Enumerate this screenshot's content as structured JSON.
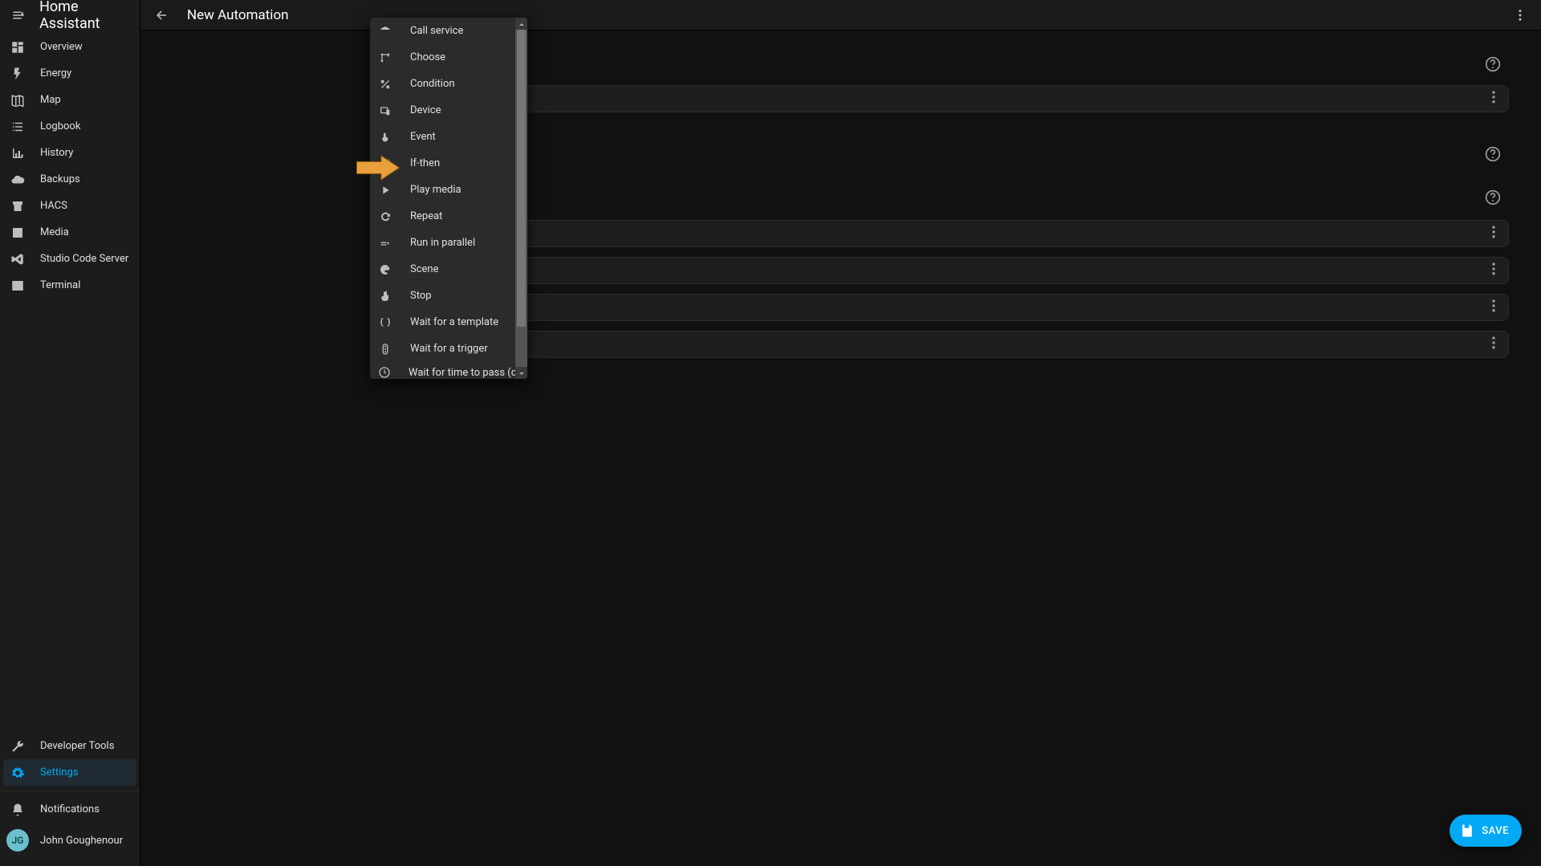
{
  "brand": "Home Assistant",
  "page_title": "New Automation",
  "sidebar": [
    {
      "label": "Overview",
      "icon": "dashboard"
    },
    {
      "label": "Energy",
      "icon": "bolt"
    },
    {
      "label": "Map",
      "icon": "map"
    },
    {
      "label": "Logbook",
      "icon": "list"
    },
    {
      "label": "History",
      "icon": "chart"
    },
    {
      "label": "Backups",
      "icon": "cloud"
    },
    {
      "label": "HACS",
      "icon": "store"
    },
    {
      "label": "Media",
      "icon": "play-box"
    },
    {
      "label": "Studio Code Server",
      "icon": "vscode"
    },
    {
      "label": "Terminal",
      "icon": "terminal"
    }
  ],
  "sidebar_bottom": [
    {
      "label": "Developer Tools",
      "icon": "wrench"
    },
    {
      "label": "Settings",
      "icon": "gear",
      "active": true
    }
  ],
  "notifications_label": "Notifications",
  "user": {
    "initials": "JG",
    "name": "John Goughenour"
  },
  "dropdown_options": [
    {
      "label": "Call service",
      "icon": "bell"
    },
    {
      "label": "Choose",
      "icon": "branch"
    },
    {
      "label": "Condition",
      "icon": "percent"
    },
    {
      "label": "Device",
      "icon": "device"
    },
    {
      "label": "Event",
      "icon": "touch"
    },
    {
      "label": "If-then",
      "icon": "branch",
      "highlighted": true
    },
    {
      "label": "Play media",
      "icon": "play"
    },
    {
      "label": "Repeat",
      "icon": "refresh"
    },
    {
      "label": "Run in parallel",
      "icon": "parallel"
    },
    {
      "label": "Scene",
      "icon": "palette"
    },
    {
      "label": "Stop",
      "icon": "hand"
    },
    {
      "label": "Wait for a template",
      "icon": "braces"
    },
    {
      "label": "Wait for a trigger",
      "icon": "traffic"
    },
    {
      "label": "Wait for time to pass (delay)",
      "icon": "clock"
    }
  ],
  "save_label": "SAVE"
}
